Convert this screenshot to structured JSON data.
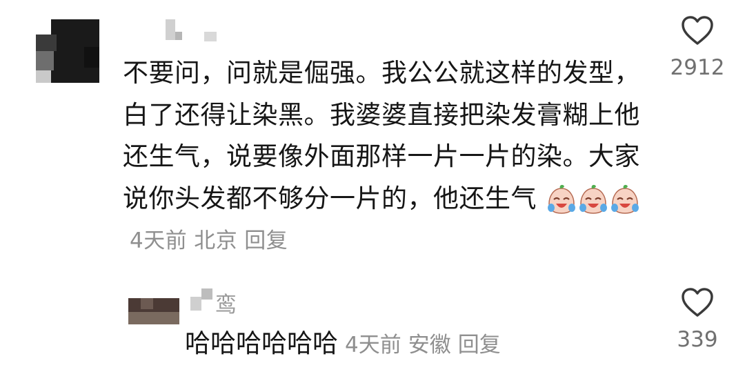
{
  "comments": [
    {
      "text": "不要问，问就是倔强。我公公就这样的发型，白了还得让染黑。我婆婆直接把染发膏糊上他还生气，说要像外面那样一片一片的染。大家说你头发都不够分一片的，他还生气",
      "time": "4天前",
      "location": "北京",
      "reply_label": "回复",
      "likes": "2912",
      "emoji_icons": [
        "crying-laughing-emoji-icon",
        "crying-laughing-emoji-icon",
        "crying-laughing-emoji-icon"
      ]
    },
    {
      "username_visible_char": "鸾",
      "text": "哈哈哈哈哈哈",
      "time": "4天前",
      "location": "安徽",
      "reply_label": "回复",
      "likes": "339"
    }
  ],
  "colors": {
    "text": "#161616",
    "meta": "#8f8f8f",
    "like_outline": "#3a3a3a",
    "emoji_face": "#f5c8b8",
    "emoji_tear": "#5aa9e6"
  },
  "icons": [
    "heart-outline-icon"
  ]
}
